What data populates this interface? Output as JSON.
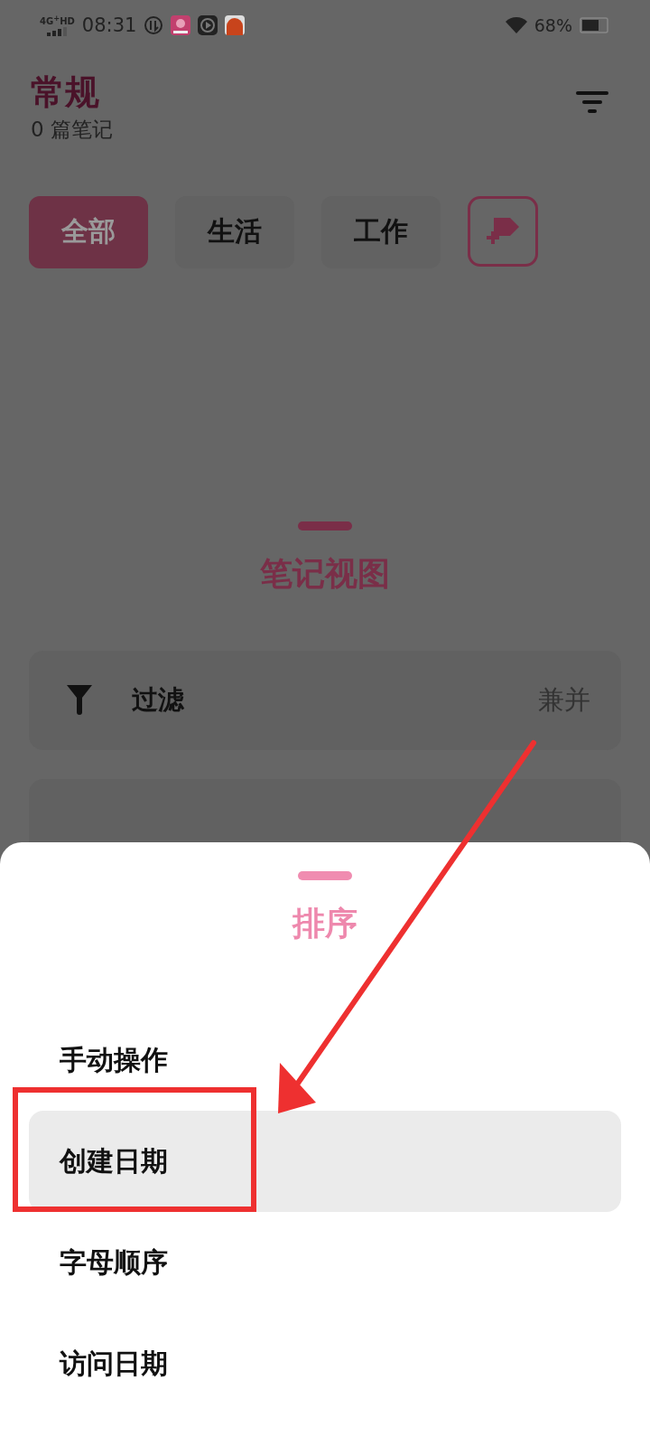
{
  "status_bar": {
    "network": "4G$^{+}$HD",
    "time": "08:31",
    "battery": "68%"
  },
  "header": {
    "title": "常规",
    "subtitle": "0 篇笔记"
  },
  "tags": [
    {
      "label": "全部",
      "selected": true
    },
    {
      "label": "生活",
      "selected": false
    },
    {
      "label": "工作",
      "selected": false
    }
  ],
  "view_sheet": {
    "title": "笔记视图",
    "rows": [
      {
        "label": "过滤",
        "value": "兼并"
      }
    ]
  },
  "sort_sheet": {
    "title": "排序",
    "options": [
      {
        "label": "手动操作",
        "selected": false
      },
      {
        "label": "创建日期",
        "selected": true
      },
      {
        "label": "字母顺序",
        "selected": false
      },
      {
        "label": "访问日期",
        "selected": false
      }
    ]
  }
}
